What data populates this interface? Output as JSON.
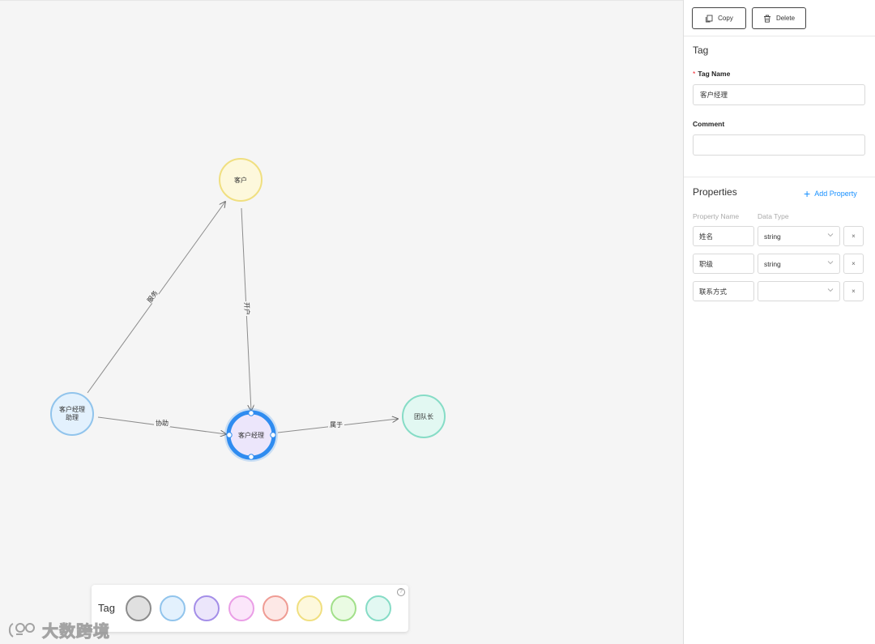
{
  "graph": {
    "nodes": [
      {
        "id": "customer",
        "label": "客户",
        "fill": "#fdf8dc",
        "stroke": "#f0df80"
      },
      {
        "id": "assistant",
        "label_line1": "客户经理",
        "label_line2": "助理",
        "fill": "#e3f1fd",
        "stroke": "#91c4ec"
      },
      {
        "id": "manager",
        "label": "客户经理",
        "fill": "#ece6fb",
        "stroke": "#2f8cf0",
        "selected": true
      },
      {
        "id": "leader",
        "label": "团队长",
        "fill": "#e2f8f2",
        "stroke": "#86dcc6"
      }
    ],
    "edges": [
      {
        "label": "服务"
      },
      {
        "label": "开户"
      },
      {
        "label": "协助"
      },
      {
        "label": "属于"
      }
    ]
  },
  "palette": {
    "label": "Tag",
    "help": "?",
    "swatches": [
      {
        "fill": "#e0e0e0",
        "stroke": "#8c8c8c"
      },
      {
        "fill": "#e3f1fd",
        "stroke": "#91c4ec"
      },
      {
        "fill": "#ece6fb",
        "stroke": "#a48ee8"
      },
      {
        "fill": "#fbe6fa",
        "stroke": "#ea9ee6"
      },
      {
        "fill": "#fde8e6",
        "stroke": "#ef9c94"
      },
      {
        "fill": "#fdf8dc",
        "stroke": "#f0df80"
      },
      {
        "fill": "#eafbe3",
        "stroke": "#a2e08a"
      },
      {
        "fill": "#e2f8f2",
        "stroke": "#86dcc6"
      }
    ]
  },
  "watermark": {
    "text": "大数跨境"
  },
  "toolbar": {
    "copy_label": "Copy",
    "delete_label": "Delete"
  },
  "panel": {
    "section_title": "Tag",
    "tag_name_label": "Tag Name",
    "tag_name_value": "客户经理",
    "comment_label": "Comment",
    "comment_value": "",
    "properties_title": "Properties",
    "add_property_label": "Add Property",
    "col_property_name": "Property Name",
    "col_data_type": "Data Type",
    "properties": [
      {
        "name": "姓名",
        "type": "string"
      },
      {
        "name": "职级",
        "type": "string"
      },
      {
        "name": "联系方式",
        "type": ""
      }
    ],
    "delete_glyph": "×"
  },
  "colors": {
    "accent": "#1890ff",
    "required": "#f5222d"
  }
}
